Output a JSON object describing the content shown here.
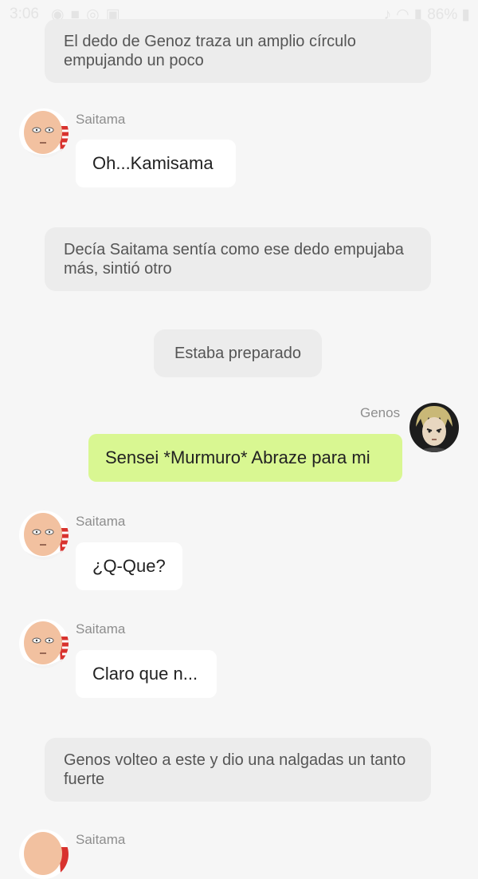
{
  "status_bar": {
    "time": "3:06",
    "battery": "86%"
  },
  "messages": {
    "m1": {
      "text": "El dedo de Genoz traza un amplio círculo empujando un poco"
    },
    "m2": {
      "sender": "Saitama",
      "text": "Oh...Kamisama"
    },
    "m3": {
      "text": "Decía Saitama sentía como ese dedo empujaba más, sintió otro"
    },
    "m4": {
      "text": "Estaba preparado"
    },
    "m5": {
      "sender": "Genos",
      "text": "Sensei *Murmuro* Abraze para mi"
    },
    "m6": {
      "sender": "Saitama",
      "text": "¿Q-Que?"
    },
    "m7": {
      "sender": "Saitama",
      "text": "Claro que n..."
    },
    "m8": {
      "text": "Genos volteo a este y dio una nalgadas un tanto fuerte"
    },
    "m9": {
      "sender": "Saitama"
    }
  },
  "colors": {
    "background": "#f6f6f6",
    "narration_bg": "#ececec",
    "incoming_bubble": "#ffffff",
    "outgoing_bubble": "#d9f792"
  }
}
